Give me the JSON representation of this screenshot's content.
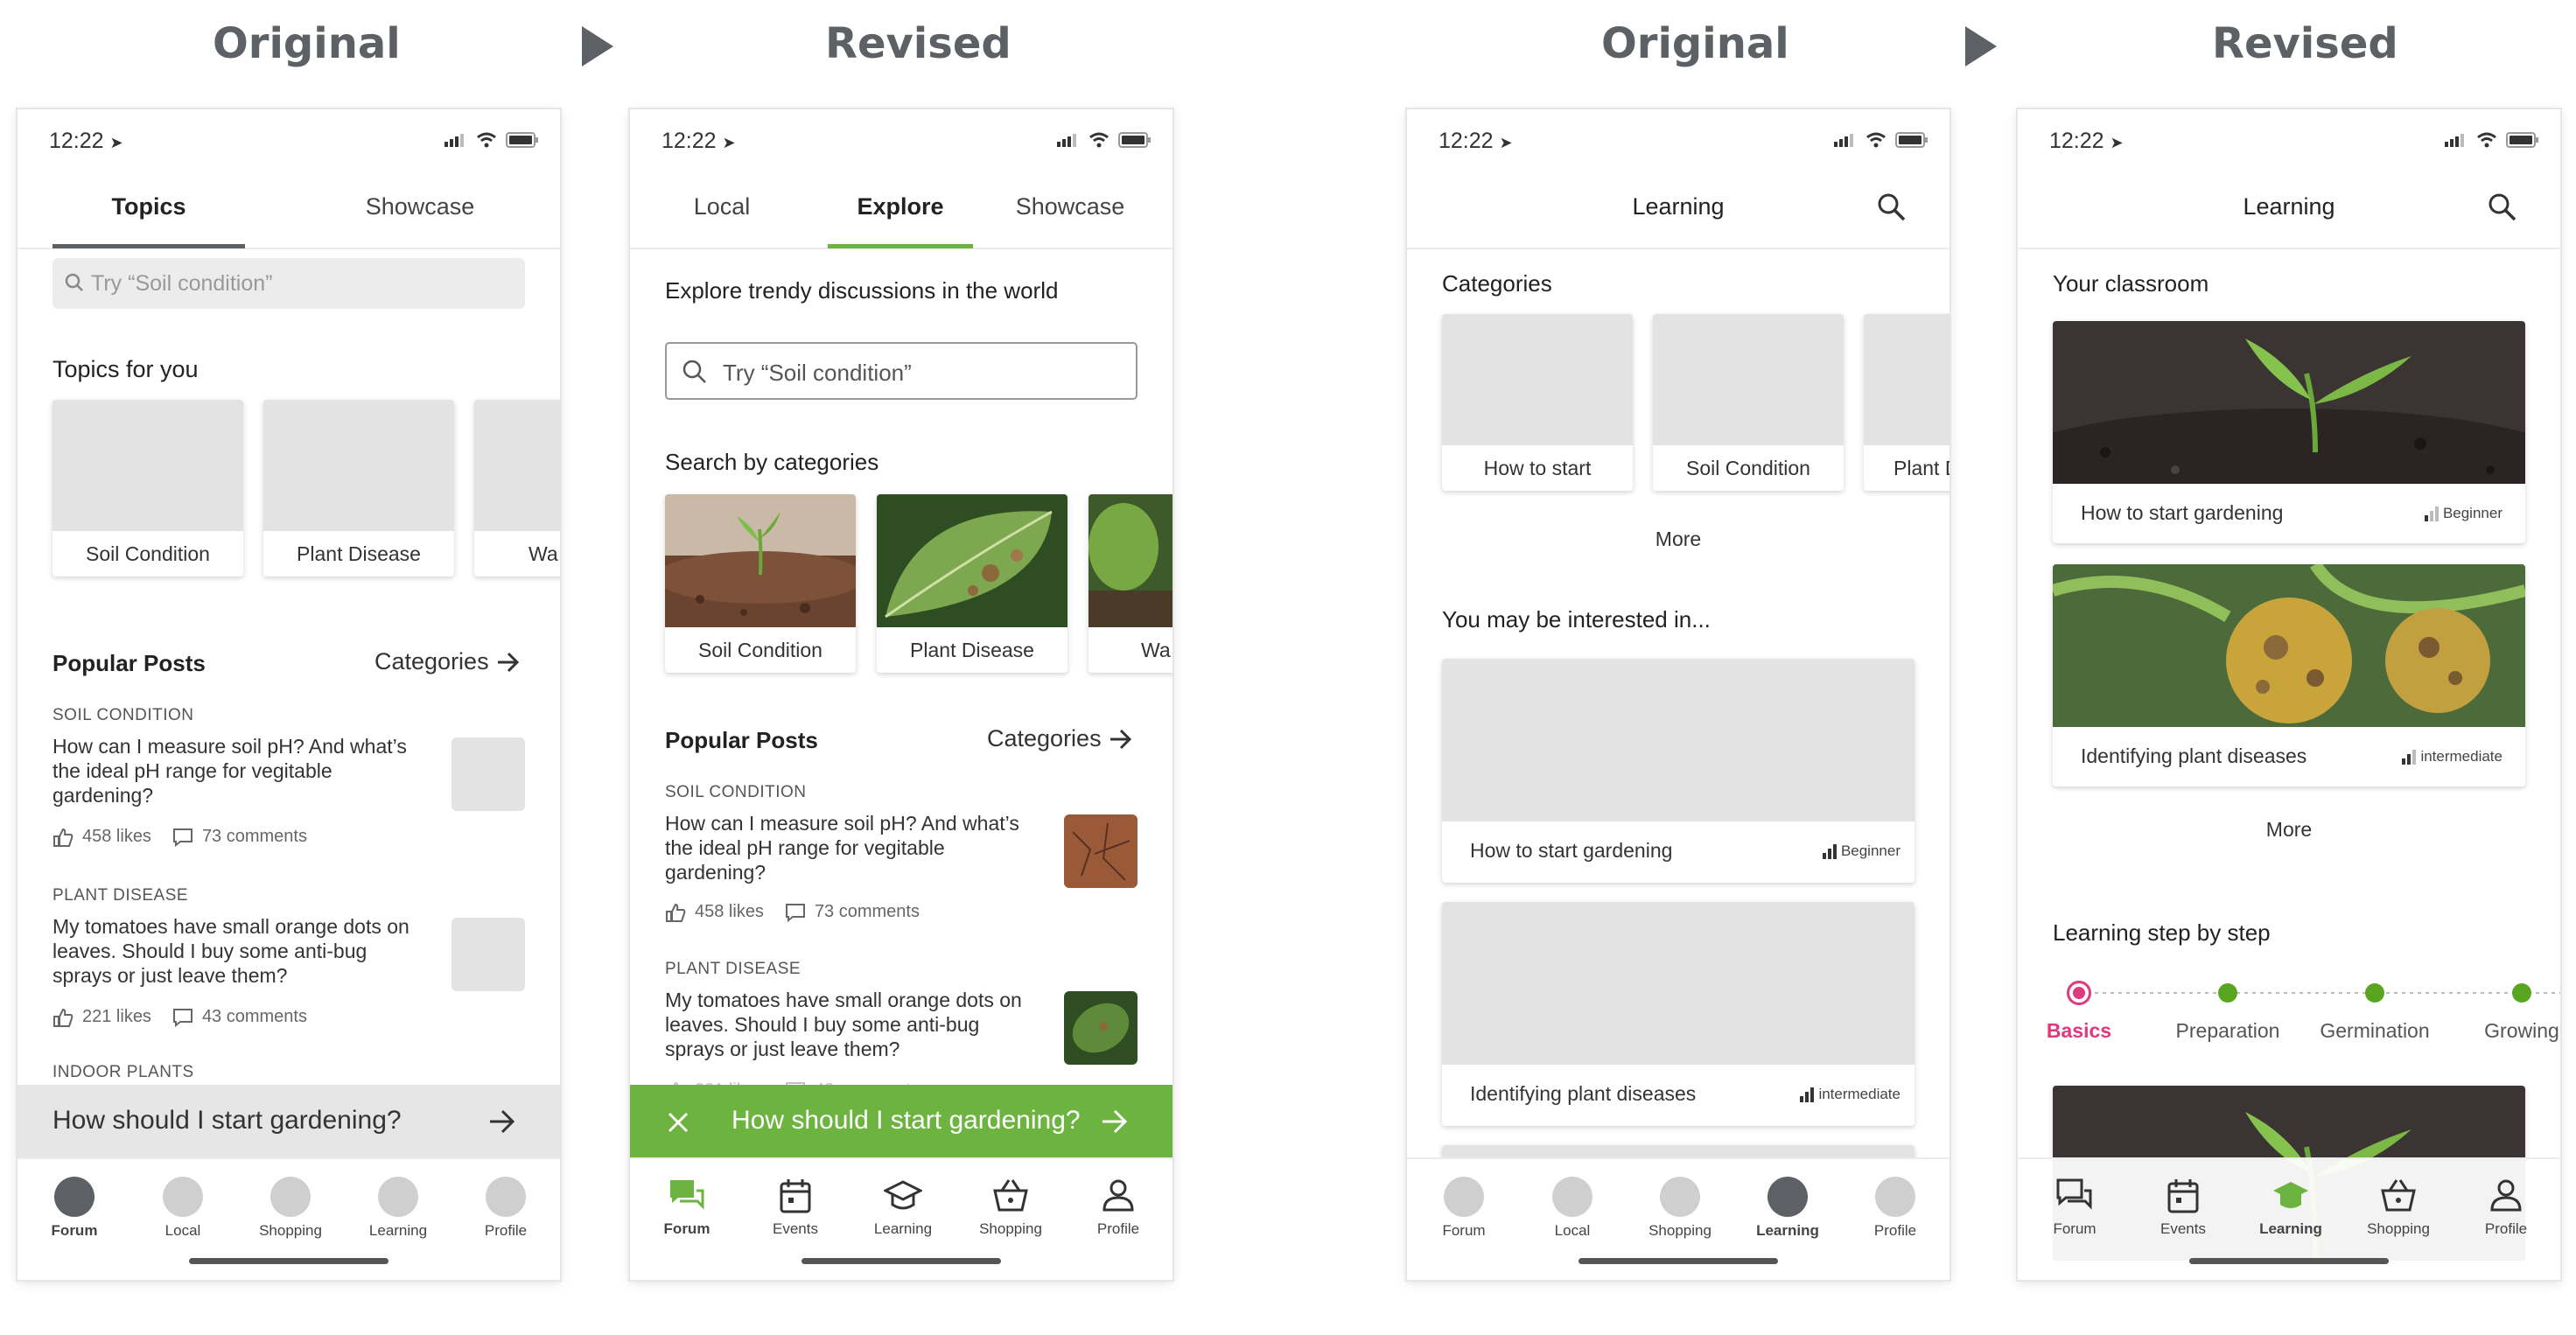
{
  "headers": {
    "h1": "Original",
    "h2": "Revised",
    "h3": "Original",
    "h4": "Revised"
  },
  "colors": {
    "accent_green": "#6cb33f",
    "accent_pink": "#e0387e",
    "step_green": "#5aa520",
    "heading_gray": "#5d6064",
    "placeholder_gray": "#e3e3e3"
  },
  "status": {
    "time": "12:22"
  },
  "p1": {
    "tabs": [
      "Topics",
      "Showcase"
    ],
    "search_placeholder": "Try “Soil condition”",
    "topics_title": "Topics for you",
    "topics": [
      "Soil Condition",
      "Plant Disease",
      "Wa"
    ],
    "popular_title": "Popular Posts",
    "categories_link": "Categories",
    "posts": [
      {
        "category": "SOIL CONDITION",
        "body": "How can I measure soil pH? And what’s the ideal pH range for vegitable gardening?",
        "likes": "458 likes",
        "comments": "73 comments"
      },
      {
        "category": "PLANT DISEASE",
        "body": "My tomatoes have small orange dots on leaves. Should I buy some anti-bug sprays or just leave them?",
        "likes": "221 likes",
        "comments": "43 comments"
      }
    ],
    "third_category": "INDOOR PLANTS",
    "banner": "How should I start gardening?",
    "nav": [
      "Forum",
      "Local",
      "Shopping",
      "Learning",
      "Profile"
    ]
  },
  "p2": {
    "tabs": [
      "Local",
      "Explore",
      "Showcase"
    ],
    "explore_title": "Explore trendy discussions in the world",
    "search_placeholder": "Try “Soil condition”",
    "categories_title": "Search by categories",
    "categories": [
      "Soil Condition",
      "Plant Disease",
      "Wa"
    ],
    "popular_title": "Popular Posts",
    "categories_link": "Categories",
    "posts": [
      {
        "category": "SOIL CONDITION",
        "body": "How can I measure soil pH? And what’s the ideal pH range for vegitable gardening?",
        "likes": "458 likes",
        "comments": "73 comments"
      },
      {
        "category": "PLANT DISEASE",
        "body": "My tomatoes have small orange dots on leaves. Should I buy some anti-bug sprays or just leave them?",
        "likes": "221 likes",
        "comments": "43 comments"
      }
    ],
    "banner": "How should I start gardening?",
    "nav": [
      "Forum",
      "Events",
      "Learning",
      "Shopping",
      "Profile"
    ]
  },
  "p3": {
    "title": "Learning",
    "categories_title": "Categories",
    "categories": [
      "How to start",
      "Soil Condition",
      "Plant D"
    ],
    "more": "More",
    "interested_title": "You may be interested in...",
    "courses": [
      {
        "name": "How to start gardening",
        "level": "Beginner",
        "level_value": 1
      },
      {
        "name": "Identifying plant diseases",
        "level": "intermediate",
        "level_value": 2
      }
    ],
    "nav": [
      "Forum",
      "Local",
      "Shopping",
      "Learning",
      "Profile"
    ]
  },
  "p4": {
    "title": "Learning",
    "classroom_title": "Your classroom",
    "courses": [
      {
        "name": "How to start gardening",
        "level": "Beginner",
        "level_value": 1
      },
      {
        "name": "Identifying plant diseases",
        "level": "intermediate",
        "level_value": 2
      }
    ],
    "more": "More",
    "steps_title": "Learning step by step",
    "steps": [
      "Basics",
      "Preparation",
      "Germination",
      "Growing"
    ],
    "nav": [
      "Forum",
      "Events",
      "Learning",
      "Shopping",
      "Profile"
    ]
  }
}
